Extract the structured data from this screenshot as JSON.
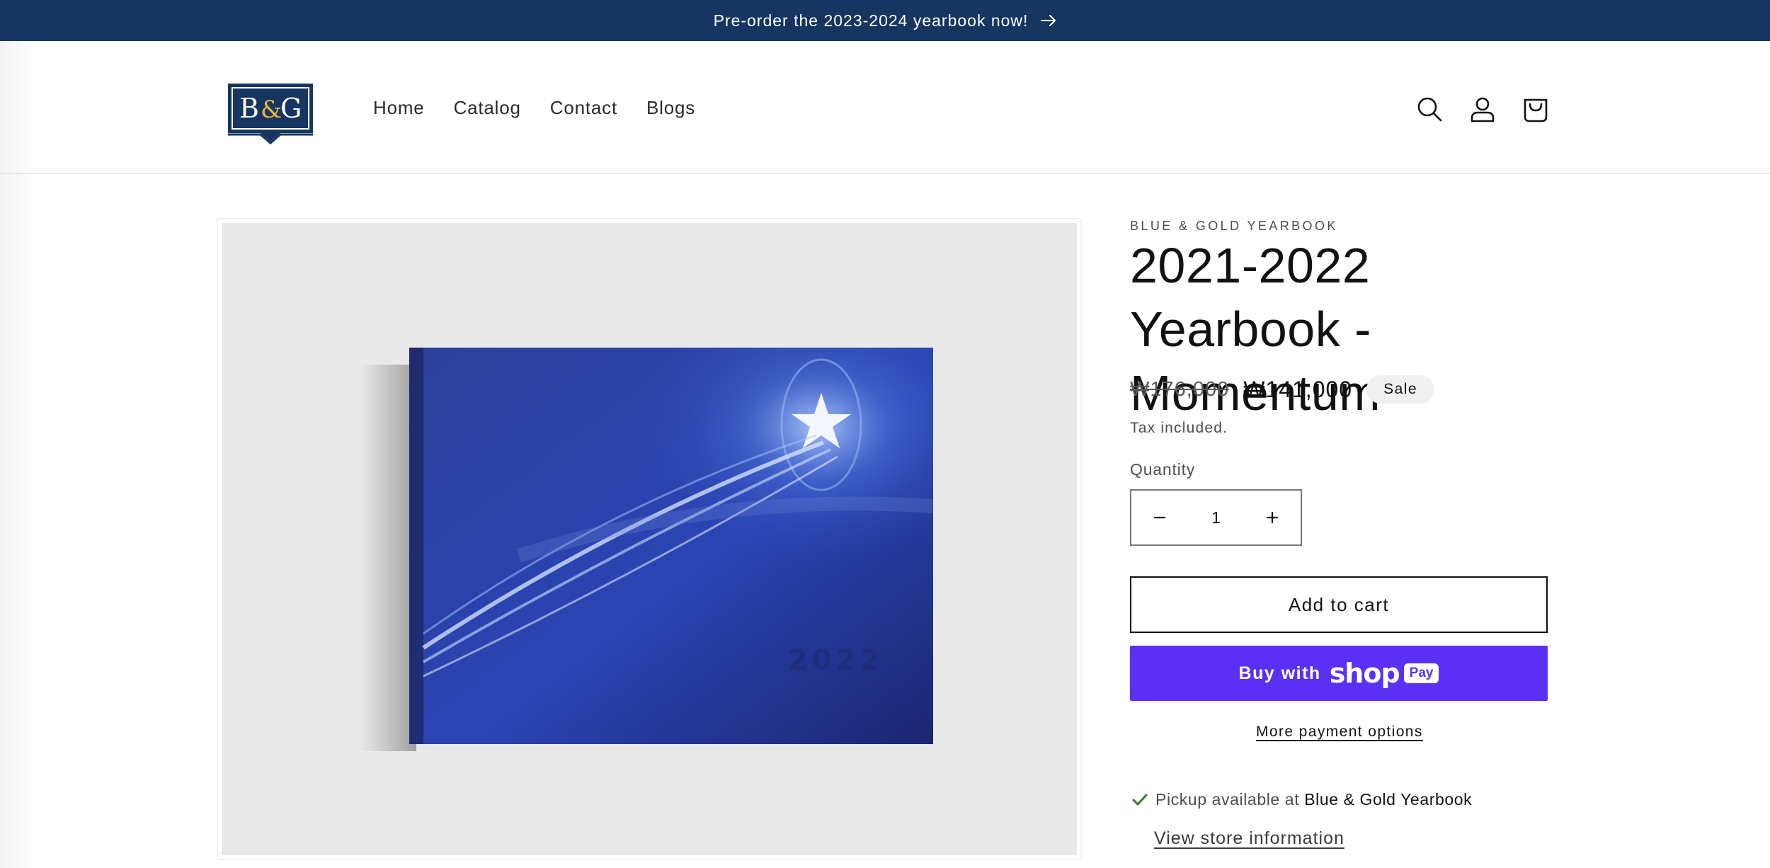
{
  "announcement": {
    "text": "Pre-order the 2023-2024 yearbook now!"
  },
  "brand": {
    "logo_text": "B&G",
    "logo_primary": "#163561",
    "logo_accent": "#e8b53a"
  },
  "nav": {
    "items": [
      "Home",
      "Catalog",
      "Contact",
      "Blogs"
    ]
  },
  "header_icons": [
    "search-icon",
    "account-icon",
    "cart-icon"
  ],
  "product": {
    "vendor": "BLUE & GOLD YEARBOOK",
    "title": "2021-2022 Yearbook - Momentum",
    "price_regular": "₩176,000",
    "price_sale": "₩141,000",
    "badge": "Sale",
    "tax_note": "Tax included.",
    "image_cover_text": "2022"
  },
  "quantity": {
    "label": "Quantity",
    "value": "1"
  },
  "buttons": {
    "add_to_cart": "Add to cart",
    "buy_with": "Buy with",
    "shop_pay_word": "shop",
    "shop_pay_pill": "Pay",
    "more_payment_options": "More payment options"
  },
  "pickup": {
    "prefix": "Pickup available at",
    "store": "Blue & Gold Yearbook",
    "view_store": "View store information"
  },
  "colors": {
    "announcement_bg": "#163561",
    "shop_pay": "#5a31f4",
    "check": "#2e7d32"
  }
}
